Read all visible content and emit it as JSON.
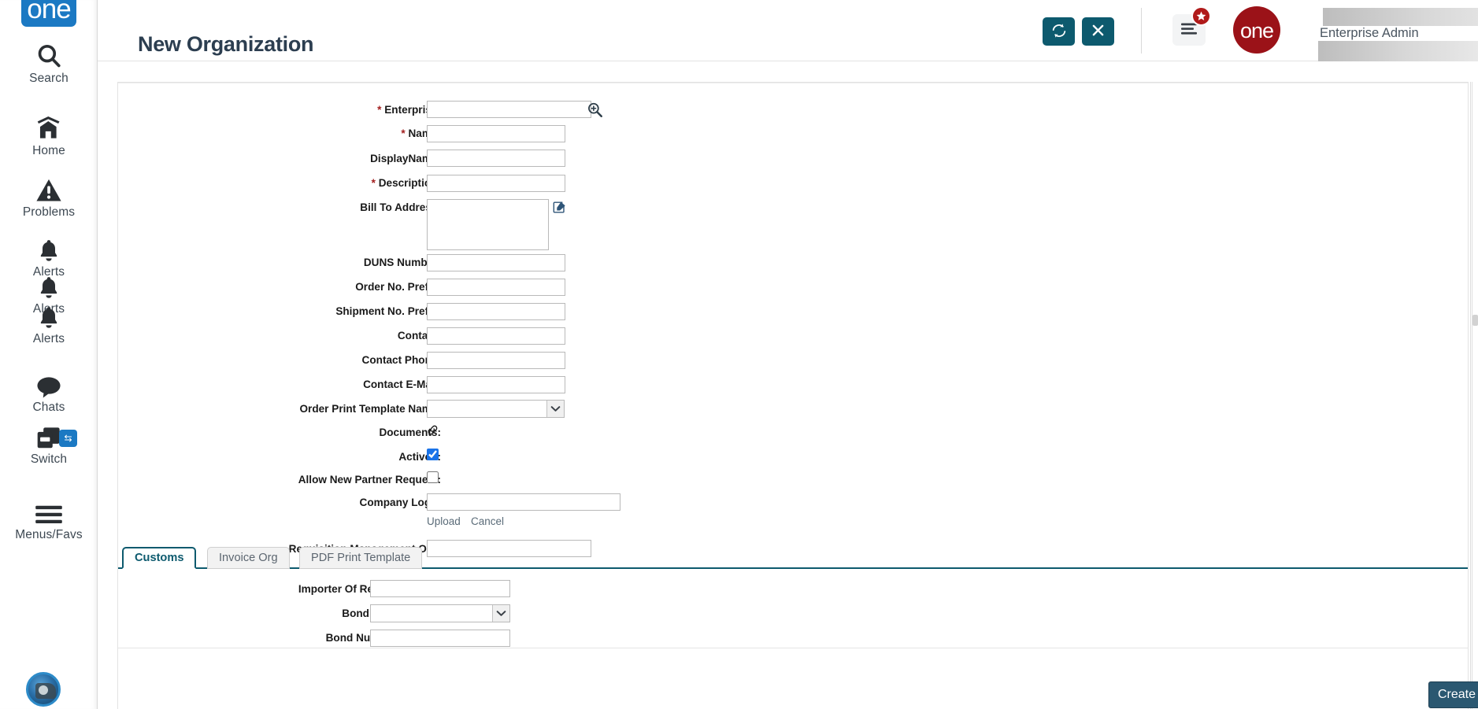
{
  "sidebar": {
    "brand": "one",
    "items": [
      {
        "label": "Search",
        "icon": "search-icon"
      },
      {
        "label": "Home",
        "icon": "home-icon"
      },
      {
        "label": "Problems",
        "icon": "warning-triangle-icon"
      },
      {
        "label": "Alerts",
        "icon": "bell-icon"
      },
      {
        "label": "Alerts",
        "icon": "bell-icon"
      },
      {
        "label": "Alerts",
        "icon": "bell-icon"
      },
      {
        "label": "Chats",
        "icon": "chat-bubble-icon"
      },
      {
        "label": "Switch",
        "icon": "switch-windows-icon",
        "badge_icon": "swap-arrows-icon"
      },
      {
        "label": "Menus/Favs",
        "icon": "hamburger-icon"
      }
    ],
    "avatar": "user-avatar-icon"
  },
  "header": {
    "title": "New Organization",
    "refresh_icon": "refresh-icon",
    "close_icon": "close-x-icon",
    "menu_icon": "list-menu-icon",
    "menu_badge_icon": "star-icon",
    "logo_text": "one",
    "user_name": "Enterprise Admin",
    "caret_icon": "chevron-down-icon"
  },
  "form": {
    "fields": [
      {
        "label": "Enterprise:",
        "required": true,
        "type": "text-with-search",
        "value": "",
        "icon": "magnifier-plus-icon"
      },
      {
        "label": "Name:",
        "required": true,
        "type": "text",
        "value": ""
      },
      {
        "label": "DisplayName:",
        "required": false,
        "type": "text",
        "value": ""
      },
      {
        "label": "Description:",
        "required": true,
        "type": "text",
        "value": ""
      },
      {
        "label": "Bill To Address:",
        "required": false,
        "type": "textarea",
        "value": "",
        "icon": "edit-pencil-icon"
      },
      {
        "label": "DUNS Number:",
        "required": false,
        "type": "text",
        "value": ""
      },
      {
        "label": "Order No. Prefix:",
        "required": false,
        "type": "text",
        "value": ""
      },
      {
        "label": "Shipment No. Prefix:",
        "required": false,
        "type": "text",
        "value": ""
      },
      {
        "label": "Contact:",
        "required": false,
        "type": "text",
        "value": ""
      },
      {
        "label": "Contact Phone:",
        "required": false,
        "type": "text",
        "value": ""
      },
      {
        "label": "Contact E-Mail:",
        "required": false,
        "type": "text",
        "value": ""
      },
      {
        "label": "Order Print Template Name:",
        "required": false,
        "type": "select",
        "value": "",
        "options": [
          ""
        ]
      },
      {
        "label": "Documents:",
        "required": false,
        "type": "link-icon",
        "icon": "chain-link-icon"
      },
      {
        "label": "Active?:",
        "required": false,
        "type": "checkbox",
        "checked": true
      },
      {
        "label": "Allow New Partner Request:",
        "required": false,
        "type": "checkbox",
        "checked": false
      },
      {
        "label": "Company Logo:",
        "required": false,
        "type": "file-text",
        "value": ""
      },
      {
        "label": "Requisition Management Org:",
        "required": false,
        "type": "text",
        "value": ""
      }
    ],
    "upload_link": "Upload",
    "cancel_link": "Cancel"
  },
  "tabs": [
    {
      "label": "Customs",
      "active": true
    },
    {
      "label": "Invoice Org",
      "active": false
    },
    {
      "label": "PDF Print Template",
      "active": false
    }
  ],
  "customs_tab": {
    "fields": [
      {
        "label": "Importer Of Record:",
        "type": "text",
        "value": ""
      },
      {
        "label": "Bond Type:",
        "type": "select",
        "value": "",
        "options": [
          ""
        ]
      },
      {
        "label": "Bond Number:",
        "type": "text",
        "value": ""
      }
    ]
  },
  "footer": {
    "create_label": "Create"
  },
  "colors": {
    "accent_teal": "#0d5a6e",
    "brand_blue": "#1b79c3",
    "logo_red": "#9b1218",
    "create_button": "#2b5871",
    "required_star": "#a32020"
  }
}
